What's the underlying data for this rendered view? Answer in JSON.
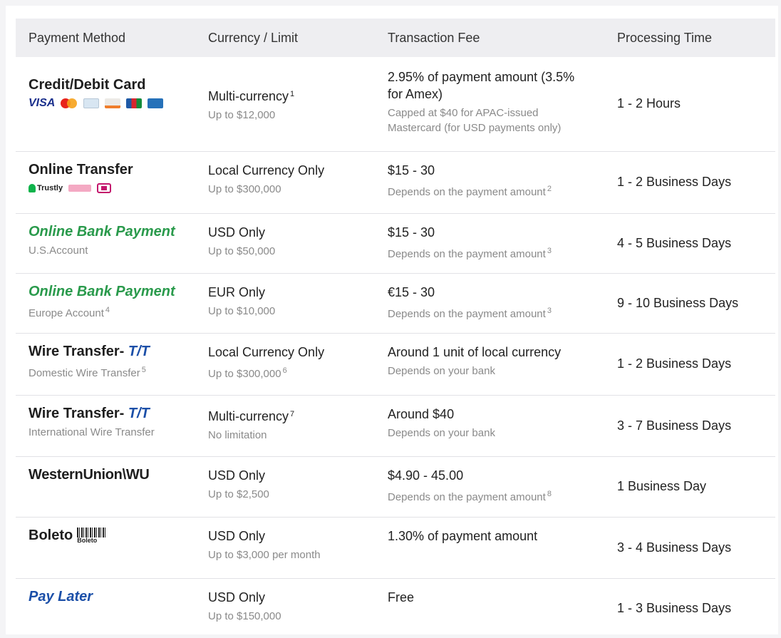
{
  "headers": {
    "method": "Payment Method",
    "currency": "Currency / Limit",
    "fee": "Transaction Fee",
    "time": "Processing Time"
  },
  "rows": [
    {
      "method": "Credit/Debit Card",
      "method_logos": [
        "visa-logo",
        "mastercard-logo",
        "amex-card-logo",
        "discover-logo",
        "jcb-logo",
        "amex-logo"
      ],
      "visa_text": "VISA",
      "currency": "Multi-currency",
      "currency_note": "1",
      "limit": "Up to $12,000",
      "fee": "2.95% of payment amount (3.5% for Amex)",
      "fee_sub": "Capped at $40 for APAC-issued Mastercard (for USD payments only)",
      "time": "1 - 2 Hours"
    },
    {
      "method": "Online Transfer",
      "trustly_text": "Trustly",
      "method_logos": [
        "trustly-logo",
        "klarna-logo",
        "ideal-logo"
      ],
      "currency": "Local Currency Only",
      "limit": "Up to $300,000",
      "fee": "$15 - 30",
      "fee_sub": "Depends on the payment amount",
      "fee_note": "2",
      "time": "1 - 2 Business Days"
    },
    {
      "method": "Online Bank Payment",
      "method_sub": "U.S.Account",
      "currency": "USD Only",
      "limit": "Up to $50,000",
      "fee": "$15 - 30",
      "fee_sub": "Depends on the payment amount",
      "fee_note": "3",
      "time": "4 - 5 Business Days"
    },
    {
      "method": "Online Bank Payment",
      "method_sub": "Europe Account",
      "method_note": "4",
      "currency": "EUR Only",
      "limit": "Up to $10,000",
      "fee": "€15 - 30",
      "fee_sub": "Depends on the payment amount",
      "fee_note": "3",
      "time": "9 - 10 Business Days"
    },
    {
      "method": "Wire Transfer-",
      "method_tt": "T/T",
      "method_sub": "Domestic Wire Transfer",
      "method_note": "5",
      "currency": "Local Currency Only",
      "limit": "Up to $300,000",
      "limit_note": "6",
      "fee": "Around 1 unit of local currency",
      "fee_sub": "Depends on your bank",
      "time": "1 - 2 Business Days"
    },
    {
      "method": "Wire Transfer-",
      "method_tt": "T/T",
      "method_sub": "International Wire Transfer",
      "currency": "Multi-currency",
      "currency_note": "7",
      "limit": "No limitation",
      "fee": "Around $40",
      "fee_sub": "Depends on your bank",
      "time": "3 - 7 Business Days"
    },
    {
      "method": "WesternUnion\\WU",
      "currency": "USD Only",
      "limit": "Up to $2,500",
      "fee": "$4.90 - 45.00",
      "fee_sub": "Depends on the payment amount",
      "fee_note": "8",
      "time": "1 Business Day"
    },
    {
      "method": "Boleto",
      "barcode_text": "Boleto",
      "currency": "USD Only",
      "limit": "Up to $3,000 per month",
      "fee": "1.30% of payment amount",
      "time": "3 - 4 Business Days"
    },
    {
      "method": "Pay Later",
      "currency": "USD Only",
      "limit": "Up to $150,000",
      "fee": "Free",
      "time": "1 - 3 Business Days"
    }
  ],
  "colors": {
    "header_bg": "#eeeef1",
    "green_method": "#2a9a4c",
    "blue_method": "#1b4fa8",
    "muted_text": "#8a8a8a"
  }
}
